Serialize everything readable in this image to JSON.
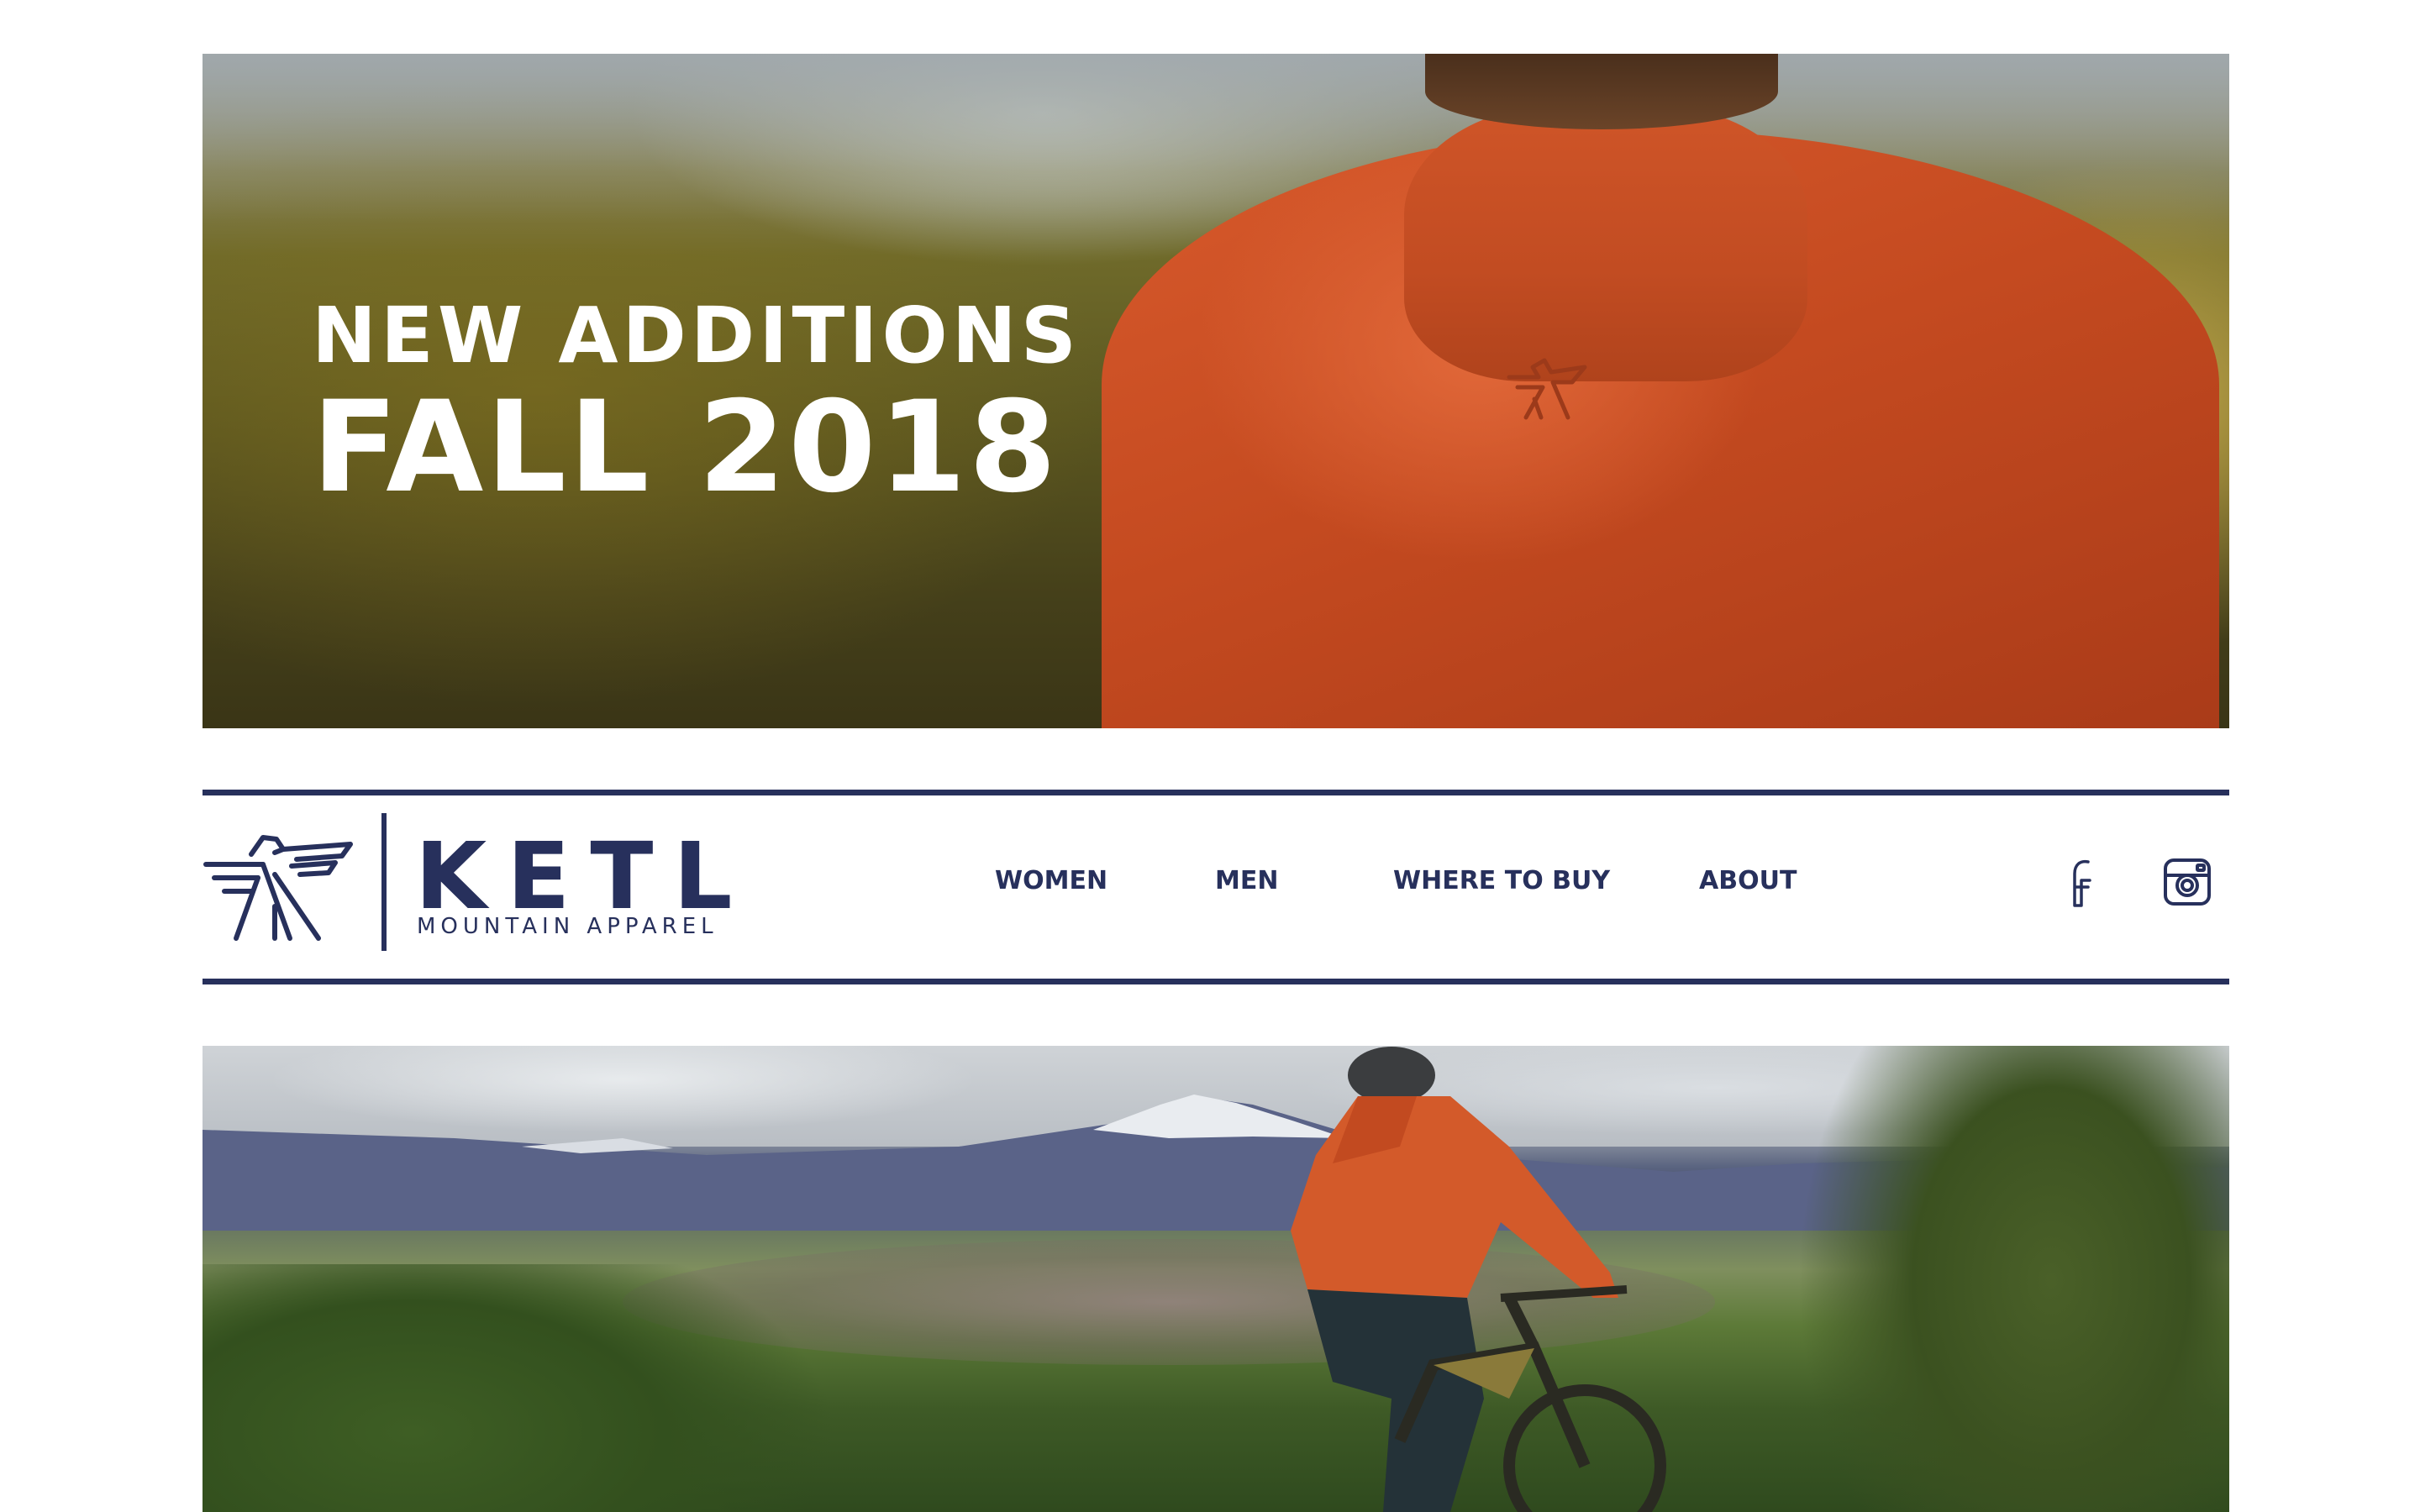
{
  "hero": {
    "line1": "NEW ADDITIONS",
    "line2": "FALL 2018"
  },
  "brand": {
    "name": "KETL",
    "tagline": "MOUNTAIN APPAREL"
  },
  "nav": {
    "items": [
      {
        "label": "WOMEN"
      },
      {
        "label": "MEN"
      },
      {
        "label": "WHERE TO BUY"
      },
      {
        "label": "ABOUT"
      }
    ]
  },
  "social": {
    "icons": [
      "facebook-icon",
      "instagram-icon"
    ]
  },
  "colors": {
    "brand_navy": "#27305c",
    "jacket_orange": "#d0552a",
    "background": "#ffffff"
  }
}
